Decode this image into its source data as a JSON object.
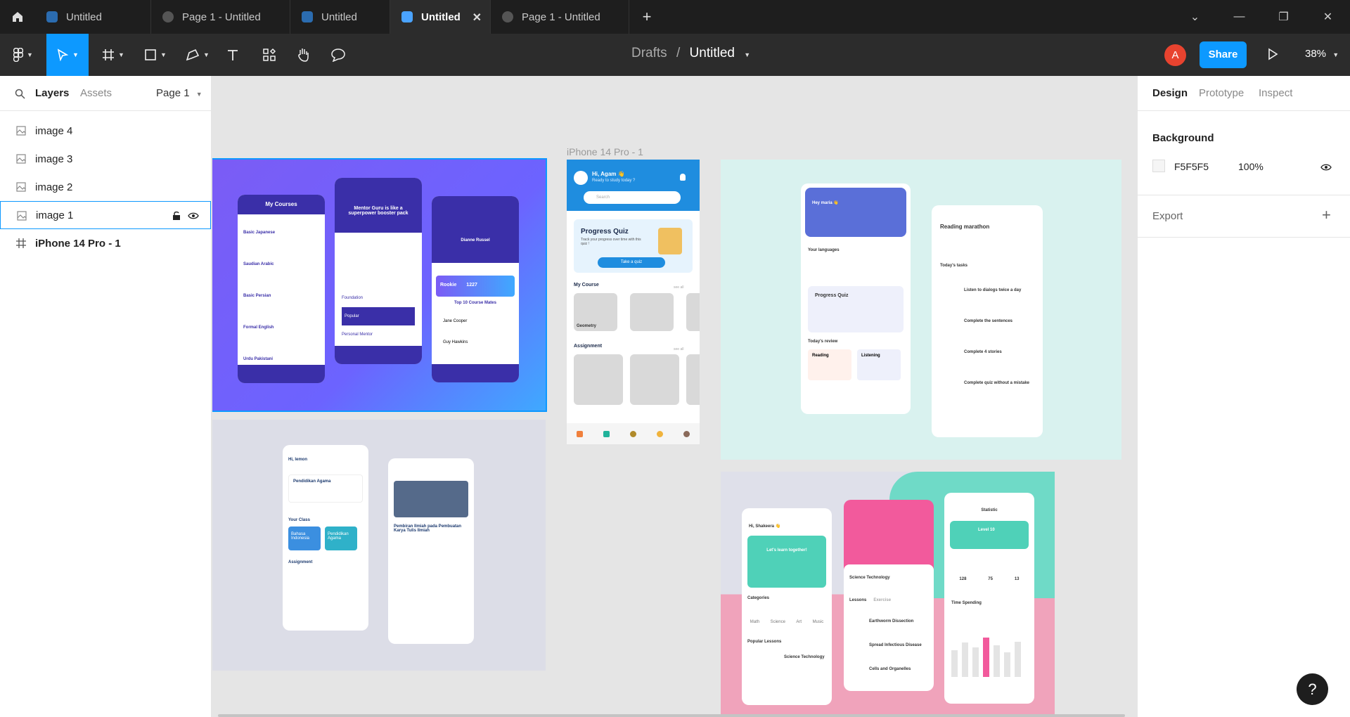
{
  "tabs": [
    {
      "label": "Untitled",
      "kind": "file",
      "active": false
    },
    {
      "label": "Page 1 - Untitled",
      "kind": "proto",
      "active": false
    },
    {
      "label": "Untitled",
      "kind": "file",
      "active": false
    },
    {
      "label": "Untitled",
      "kind": "file",
      "active": true
    },
    {
      "label": "Page 1 - Untitled",
      "kind": "proto",
      "active": false
    }
  ],
  "toolbar": {
    "breadcrumb_parent": "Drafts",
    "breadcrumb_sep": "/",
    "file_name": "Untitled",
    "avatar_initial": "A",
    "share_label": "Share",
    "zoom": "38%"
  },
  "left_panel": {
    "tab_layers": "Layers",
    "tab_assets": "Assets",
    "page_select": "Page 1",
    "layers": [
      {
        "label": "image 4",
        "type": "image"
      },
      {
        "label": "image 3",
        "type": "image"
      },
      {
        "label": "image 2",
        "type": "image"
      },
      {
        "label": "image 1",
        "type": "image",
        "selected": true
      },
      {
        "label": "iPhone 14 Pro - 1",
        "type": "frame"
      }
    ]
  },
  "canvas": {
    "frame_label": "iPhone 14 Pro - 1",
    "frame": {
      "greeting": "Hi, Agam 👋",
      "subgreeting": "Ready to study today ?",
      "search_placeholder": "Search",
      "quiz_title": "Progress Quiz",
      "quiz_desc": "Track your progress over time with this quiz !",
      "quiz_button": "Take a quiz",
      "my_course": "My Course",
      "see_all_1": "see all",
      "course_tag": "Geometry",
      "assignment": "Assignment",
      "see_all_2": "see all"
    },
    "image1": {
      "screen1_title": "My Courses",
      "courses": [
        "Basic Japanese",
        "Saudian Arabic",
        "Basic Persian",
        "Formal English",
        "Urdu Pakistani"
      ],
      "screen2_title": "Mentor Guru is like a superpower booster pack",
      "plans": [
        "Foundation",
        "Popular",
        "Personal Mentor"
      ],
      "profile_name": "Dianne Russel",
      "rank_label": "Rookie",
      "score": "1227",
      "list_title": "Top 10 Course Mates",
      "mates": [
        "Jane Cooper",
        "Guy Hawkins"
      ]
    },
    "image2": {
      "greeting": "Hi, lemon",
      "course": "Pendidikan Agama",
      "class_label": "Your Class",
      "classes": [
        "Bahasa Indonesia",
        "Pendidikan Agama"
      ],
      "assignment": "Assignment",
      "article_title": "Pembiran Ilmiah pada Pembuatan Karya Tulis Ilmiah"
    },
    "image3": {
      "greeting": "Hey maria 👋",
      "languages": "Your languages",
      "quiz_title": "Progress Quiz",
      "review": "Today's review",
      "review_items": [
        "Reading",
        "Listening"
      ],
      "marathon": "Reading marathon",
      "tasks_label": "Today's tasks",
      "tasks": [
        "Listen to dialogs twice a day",
        "Complete the sentences",
        "Complete 4 stories",
        "Complete quiz without a mistake"
      ]
    },
    "image4": {
      "greeting": "Hi, Shakeera 👋",
      "banner": "Let's learn together!",
      "categories": "Categories",
      "cats": [
        "Math",
        "Science",
        "Art",
        "Music"
      ],
      "popular": "Popular Lessons",
      "lesson": "Science Technology",
      "course_title": "Science Technology",
      "lessons_tab": "Lessons",
      "exercise_tab": "Exercise",
      "lesson_items": [
        "Earthworm Dissection",
        "Spread Infectious Disease",
        "Cells and Organelles"
      ],
      "stat_title": "Statistic",
      "level": "Level 10",
      "stats": [
        "128",
        "75",
        "13"
      ],
      "time_spending": "Time Spending"
    }
  },
  "right_panel": {
    "tab_design": "Design",
    "tab_prototype": "Prototype",
    "tab_inspect": "Inspect",
    "background_title": "Background",
    "bg_hex": "F5F5F5",
    "bg_opacity": "100%",
    "export_title": "Export"
  },
  "colors": {
    "accent": "#0d99ff",
    "dark": "#1e1e1e",
    "toolbar": "#2c2c2c",
    "canvas": "#e5e5e5"
  }
}
